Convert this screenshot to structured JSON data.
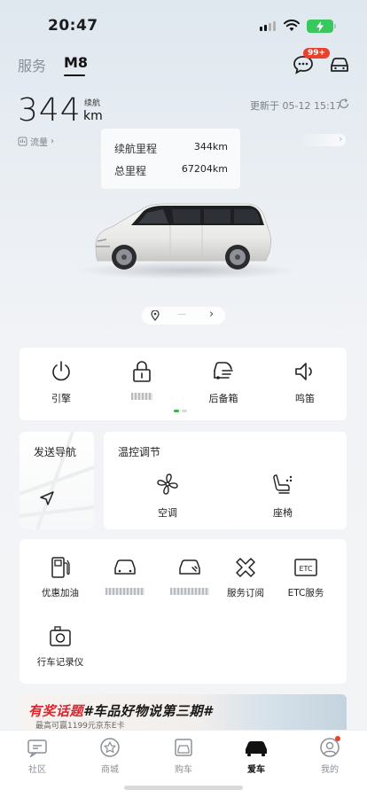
{
  "status_bar": {
    "time": "20:47"
  },
  "top_nav": {
    "tabs": [
      {
        "label": "服务"
      },
      {
        "label": "M8"
      }
    ],
    "message_badge": "99+"
  },
  "vehicle": {
    "range_value": "344",
    "range_caption": "续航",
    "range_unit": "km",
    "update_time": "更新于 05-12 15:17",
    "traffic_label": "流量",
    "mileage": {
      "range_label": "续航里程",
      "range_value": "344km",
      "odometer_label": "总里程",
      "odometer_value": "67204km"
    }
  },
  "pager": {
    "label": "—"
  },
  "controls": [
    {
      "label": "引擎",
      "icon": "power-icon"
    },
    {
      "label": "",
      "icon": "lock-icon"
    },
    {
      "label": "后备箱",
      "icon": "trunk-icon"
    },
    {
      "label": "鸣笛",
      "icon": "horn-icon"
    }
  ],
  "navigation": {
    "title": "发送导航"
  },
  "climate": {
    "title": "温控调节",
    "items": [
      {
        "label": "空调",
        "icon": "fan-icon"
      },
      {
        "label": "座椅",
        "icon": "seat-icon"
      }
    ]
  },
  "services": [
    {
      "label": "优惠加油",
      "icon": "fuel-icon"
    },
    {
      "label": "",
      "icon": "car-service-icon"
    },
    {
      "label": "",
      "icon": "car-maintenance-icon"
    },
    {
      "label": "服务订阅",
      "icon": "subscription-icon"
    },
    {
      "label": "ETC服务",
      "icon": "etc-icon"
    },
    {
      "label": "行车记录仪",
      "icon": "dashcam-icon"
    }
  ],
  "banner": {
    "title_highlight": "有奖话题",
    "title_rest": "#车品好物说第三期#",
    "subtitle": "最高可赢1199元京东E卡"
  },
  "tabbar": [
    {
      "label": "社区",
      "icon": "community-icon"
    },
    {
      "label": "商城",
      "icon": "mall-icon"
    },
    {
      "label": "购车",
      "icon": "buy-car-icon"
    },
    {
      "label": "爱车",
      "icon": "my-car-icon"
    },
    {
      "label": "我的",
      "icon": "profile-icon"
    }
  ],
  "colors": {
    "accent_green": "#3db34a",
    "badge_red": "#e8412c",
    "battery_green": "#3ac760"
  }
}
